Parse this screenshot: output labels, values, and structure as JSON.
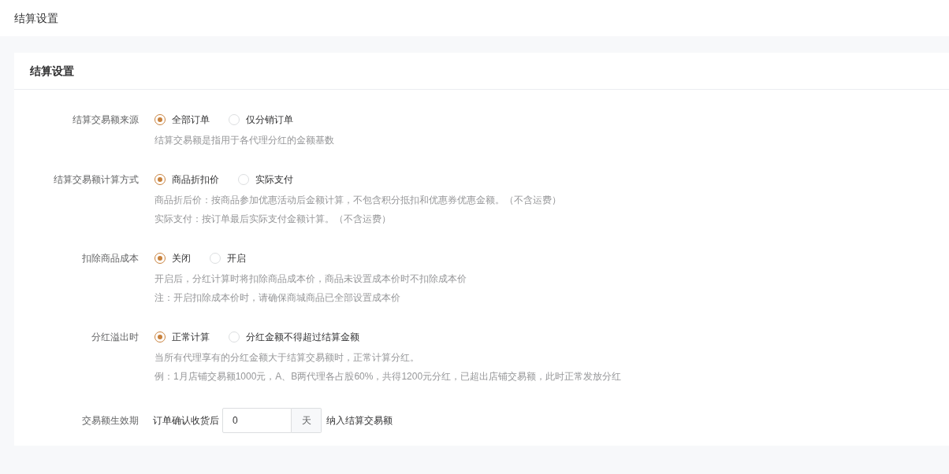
{
  "page_title": "结算设置",
  "card_title": "结算设置",
  "settings": [
    {
      "kind": "radio",
      "label": "结算交易额来源",
      "options": [
        {
          "label": "全部订单",
          "selected": true
        },
        {
          "label": "仅分销订单",
          "selected": false
        }
      ],
      "help": [
        "结算交易额是指用于各代理分红的金额基数"
      ]
    },
    {
      "kind": "radio",
      "label": "结算交易额计算方式",
      "options": [
        {
          "label": "商品折扣价",
          "selected": true
        },
        {
          "label": "实际支付",
          "selected": false
        }
      ],
      "help": [
        "商品折后价：按商品参加优惠活动后金额计算，不包含积分抵扣和优惠券优惠金额。（不含运费）",
        "实际支付：按订单最后实际支付金额计算。（不含运费）"
      ]
    },
    {
      "kind": "radio",
      "label": "扣除商品成本",
      "options": [
        {
          "label": "关闭",
          "selected": true
        },
        {
          "label": "开启",
          "selected": false
        }
      ],
      "help": [
        "开启后，分红计算时将扣除商品成本价，商品未设置成本价时不扣除成本价",
        "注：开启扣除成本价时，请确保商城商品已全部设置成本价"
      ]
    },
    {
      "kind": "radio",
      "label": "分红溢出时",
      "options": [
        {
          "label": "正常计算",
          "selected": true
        },
        {
          "label": "分红金额不得超过结算金额",
          "selected": false
        }
      ],
      "help": [
        "当所有代理享有的分红金额大于结算交易额时，正常计算分红。",
        "例：1月店铺交易额1000元，A、B两代理各占股60%，共得1200元分红，已超出店铺交易额，此时正常发放分红"
      ]
    },
    {
      "kind": "input",
      "label": "交易额生效期",
      "prefix": "订单确认收货后",
      "value": "0",
      "unit": "天",
      "suffix": "纳入结算交易额"
    }
  ]
}
